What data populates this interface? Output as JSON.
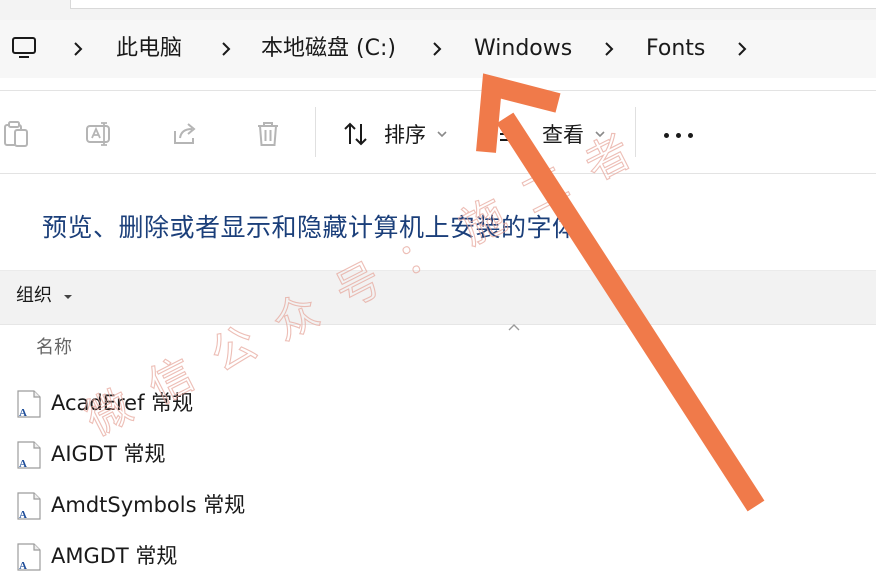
{
  "address_bar": {
    "breadcrumbs": [
      "此电脑",
      "本地磁盘 (C:)",
      "Windows",
      "Fonts"
    ]
  },
  "command_bar": {
    "sort_label": "排序",
    "view_label": "查看"
  },
  "content": {
    "heading": "预览、删除或者显示和隐藏计算机上安装的字体",
    "organize_label": "组织",
    "column_name": "名称",
    "rows": [
      {
        "label": "AcadEref 常规"
      },
      {
        "label": "AIGDT 常规"
      },
      {
        "label": "AmdtSymbols 常规"
      },
      {
        "label": "AMGDT 常规"
      }
    ]
  },
  "watermark": {
    "text": "微信公众号：施工者",
    "color": "#e7a99e"
  },
  "annotation": {
    "arrow_color": "#f07a4a"
  },
  "colors": {
    "heading": "#1b3f7a",
    "organize_bar": "#f2f2f2"
  }
}
